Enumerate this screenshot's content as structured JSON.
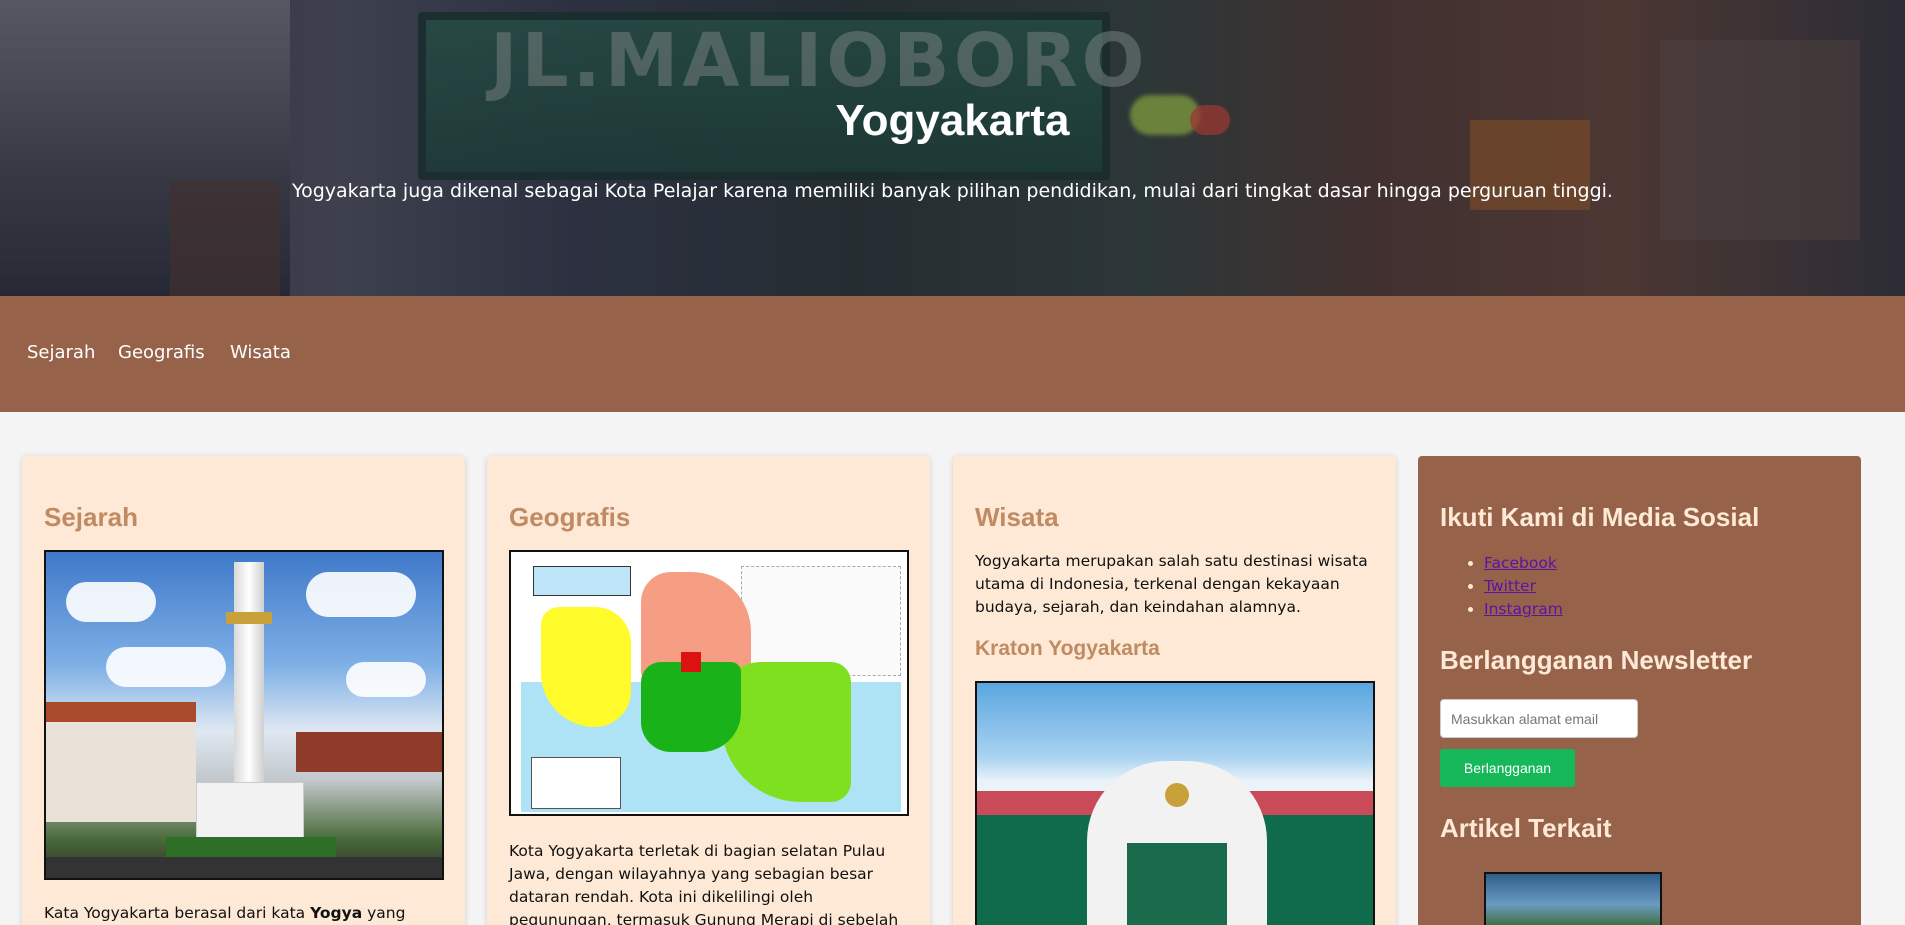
{
  "hero": {
    "title": "Yogyakarta",
    "subtitle": "Yogyakarta juga dikenal sebagai Kota Pelajar karena memiliki banyak pilihan pendidikan, mulai dari tingkat dasar hingga perguruan tinggi.",
    "background_sign_text": "JL.MALIOBORO"
  },
  "nav": {
    "items": [
      {
        "label": "Sejarah"
      },
      {
        "label": "Geografis"
      },
      {
        "label": "Wisata"
      }
    ]
  },
  "sejarah": {
    "title": "Sejarah",
    "image_alt": "Tugu Yogyakarta",
    "text_start": "Kata Yogyakarta berasal dari kata ",
    "text_bold": "Yogya",
    "text_end": " yang"
  },
  "geografis": {
    "title": "Geografis",
    "image_alt": "Peta Yogyakarta",
    "text": "Kota Yogyakarta terletak di bagian selatan Pulau Jawa, dengan wilayahnya yang sebagian besar dataran rendah. Kota ini dikelilingi oleh pegunungan, termasuk Gunung Merapi di sebelah utara."
  },
  "wisata": {
    "title": "Wisata",
    "text": "Yogyakarta merupakan salah satu destinasi wisata utama di Indonesia, terkenal dengan kekayaan budaya, sejarah, dan keindahan alamnya.",
    "subtitle": "Kraton Yogyakarta",
    "image_alt": "Kraton Yogyakarta"
  },
  "sidebar": {
    "social_title": "Ikuti Kami di Media Sosial",
    "social_links": [
      {
        "label": "Facebook"
      },
      {
        "label": "Twitter"
      },
      {
        "label": "Instagram"
      }
    ],
    "newsletter_title": "Berlangganan Newsletter",
    "email_placeholder": "Masukkan alamat email",
    "subscribe_label": "Berlangganan",
    "related_title": "Artikel Terkait"
  },
  "colors": {
    "nav_bg": "#96634a",
    "card_bg": "#fde9d6",
    "heading": "#c08a62",
    "button": "#16b85a",
    "link": "#5b12a5"
  }
}
